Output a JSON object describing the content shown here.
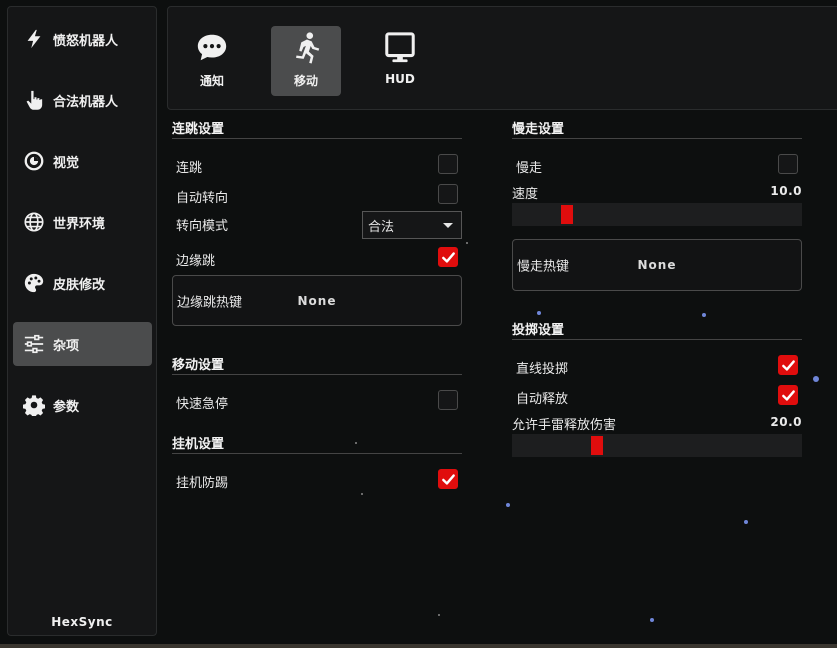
{
  "sidebar": {
    "items": [
      {
        "label": "愤怒机器人",
        "icon": "lightning-icon"
      },
      {
        "label": "合法机器人",
        "icon": "pointing-hand-icon"
      },
      {
        "label": "视觉",
        "icon": "eye-icon"
      },
      {
        "label": "世界环境",
        "icon": "globe-icon"
      },
      {
        "label": "皮肤修改",
        "icon": "palette-icon"
      },
      {
        "label": "杂项",
        "icon": "sliders-icon"
      },
      {
        "label": "参数",
        "icon": "gear-icon"
      }
    ],
    "active_index": 5,
    "brand": "HexSync"
  },
  "tabs": [
    {
      "label": "通知",
      "icon": "chat-bubble-icon"
    },
    {
      "label": "移动",
      "icon": "running-person-icon"
    },
    {
      "label": "HUD",
      "icon": "monitor-icon"
    }
  ],
  "active_tab": 1,
  "left": {
    "jump": {
      "title": "连跳设置",
      "bhop": {
        "label": "连跳",
        "checked": false
      },
      "auto_strafe": {
        "label": "自动转向",
        "checked": false
      },
      "strafe_mode": {
        "label": "转向模式",
        "value": "合法"
      },
      "edge_jump": {
        "label": "边缘跳",
        "checked": true
      },
      "edge_jump_hotkey": {
        "label": "边缘跳热键",
        "value": "None"
      }
    },
    "movement": {
      "title": "移动设置",
      "quick_stop": {
        "label": "快速急停",
        "checked": false
      }
    },
    "afk": {
      "title": "挂机设置",
      "anti_afk": {
        "label": "挂机防踢",
        "checked": true
      }
    }
  },
  "right": {
    "slowwalk": {
      "title": "慢走设置",
      "slowwalk": {
        "label": "慢走",
        "checked": false
      },
      "speed": {
        "label": "速度",
        "value": "10.0",
        "fraction": 0.08
      },
      "hotkey": {
        "label": "慢走热键",
        "value": "None"
      }
    },
    "throw": {
      "title": "投掷设置",
      "straight_throw": {
        "label": "直线投掷",
        "checked": true
      },
      "auto_release": {
        "label": "自动释放",
        "checked": true
      },
      "grenade_damage": {
        "label": "允许手雷释放伤害",
        "value": "20.0",
        "fraction": 0.2
      }
    }
  },
  "colors": {
    "accent": "#e00d0d",
    "panel": "#151617",
    "active": "#4b4c4d"
  }
}
